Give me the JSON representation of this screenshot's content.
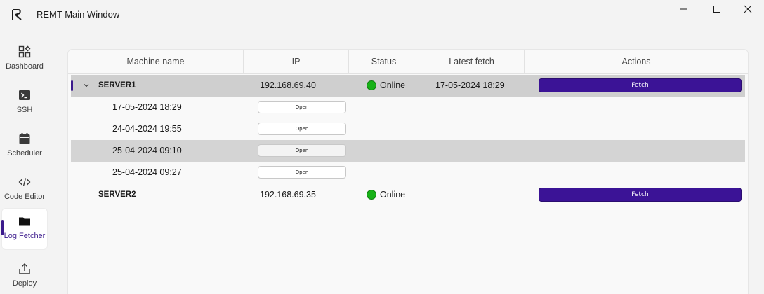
{
  "window": {
    "title": "REMT Main Window"
  },
  "sidebar": {
    "items": [
      {
        "label": "Dashboard",
        "icon": "dashboard-icon"
      },
      {
        "label": "SSH",
        "icon": "terminal-icon"
      },
      {
        "label": "Scheduler",
        "icon": "calendar-icon"
      },
      {
        "label": "Code Editor",
        "icon": "code-icon"
      },
      {
        "label": "Log Fetcher",
        "icon": "folder-icon",
        "active": true
      },
      {
        "label": "Deploy",
        "icon": "upload-icon"
      }
    ]
  },
  "table": {
    "columns": [
      "Machine name",
      "IP",
      "Status",
      "Latest fetch",
      "Actions"
    ],
    "servers": [
      {
        "name": "SERVER1",
        "ip": "192.168.69.40",
        "status": "Online",
        "latest_fetch": "17-05-2024 18:29",
        "action": "Fetch",
        "expanded": true,
        "logs": [
          {
            "date": "17-05-2024 18:29",
            "action": "Open"
          },
          {
            "date": "24-04-2024 19:55",
            "action": "Open"
          },
          {
            "date": "25-04-2024 09:10",
            "action": "Open"
          },
          {
            "date": "25-04-2024 09:27",
            "action": "Open"
          }
        ]
      },
      {
        "name": "SERVER2",
        "ip": "192.168.69.35",
        "status": "Online",
        "latest_fetch": "",
        "action": "Fetch"
      }
    ]
  },
  "colors": {
    "accent": "#3b1396",
    "online": "#17b117",
    "selected_row": "#cfcfcf"
  }
}
